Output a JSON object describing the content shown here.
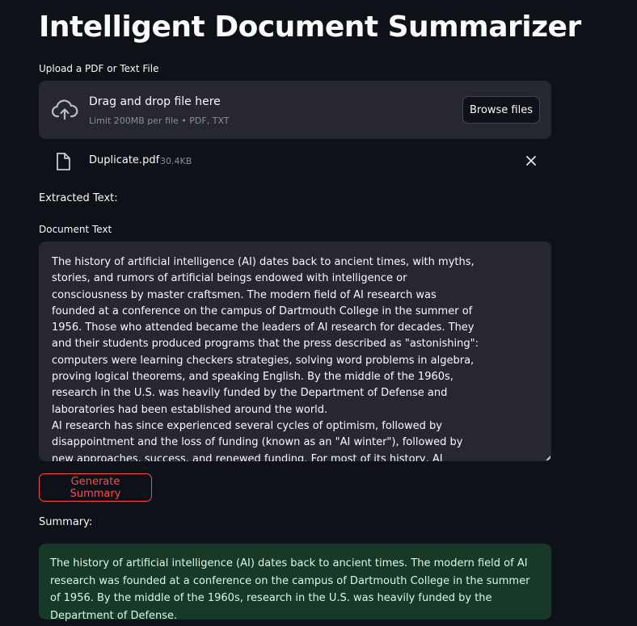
{
  "app": {
    "title": "Intelligent Document Summarizer"
  },
  "uploader": {
    "label": "Upload a PDF or Text File",
    "drop_title": "Drag and drop file here",
    "drop_subtitle": "Limit 200MB per file • PDF, TXT",
    "browse_label": "Browse files",
    "icon": "cloud-upload-icon"
  },
  "uploaded_file": {
    "name": "Duplicate.pdf",
    "size": "30.4KB",
    "icon": "file-icon",
    "remove_icon": "close-icon"
  },
  "extracted": {
    "heading": "Extracted Text:",
    "field_label": "Document Text",
    "text": "The history of artificial intelligence (AI) dates back to ancient times, with myths, stories, and rumors of artificial beings endowed with intelligence or consciousness by master craftsmen. The modern field of AI research was founded at a conference on the campus of Dartmouth College in the summer of 1956. Those who attended became the leaders of AI research for decades. They and their students produced programs that the press described as \"astonishing\": computers were learning checkers strategies, solving word problems in algebra, proving logical theorems, and speaking English. By the middle of the 1960s, research in the U.S. was heavily funded by the Department of Defense and laboratories had been established around the world.\nAI research has since experienced several cycles of optimism, followed by disappointment and the loss of funding (known as an \"AI winter\"), followed by new approaches, success, and renewed funding. For most of its history, AI research has been divided into subfields that often fail to communicate with each other. These"
  },
  "actions": {
    "generate_label": "Generate Summary"
  },
  "summary": {
    "heading": "Summary:",
    "text": "The history of artificial intelligence (AI) dates back to ancient times. The modern field of AI research was founded at a conference on the campus of Dartmouth College in the summer of 1956. By the middle of the 1960s, research in the U.S. was heavily funded by the Department of Defense."
  },
  "colors": {
    "background": "#0e1117",
    "panel": "#262730",
    "accent": "#ff4b4b",
    "success_bg": "#173928"
  }
}
